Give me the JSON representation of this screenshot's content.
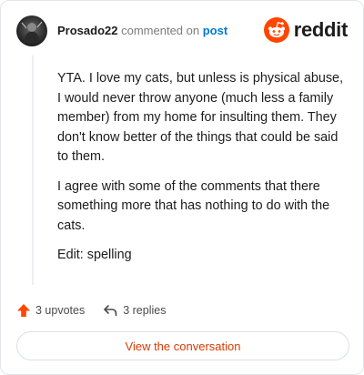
{
  "header": {
    "username": "Prosado22",
    "action_text": "commented on",
    "post_link": "post",
    "brand": "reddit"
  },
  "comment": {
    "paragraphs": [
      "YTA. I love my cats, but unless is physical abuse, I would never throw anyone (much less a family member) from my home for insulting them. They don't know better of the things that could be said to them.",
      "I agree with some of the comments that there something more that has nothing to do with the cats.",
      "Edit: spelling"
    ]
  },
  "actions": {
    "upvotes": "3 upvotes",
    "replies": "3 replies"
  },
  "view_button": "View the conversation",
  "colors": {
    "brand_orange": "#ff4500",
    "link_blue": "#0079d3",
    "cta_text": "#d93a00"
  },
  "icons": {
    "avatar": "user-avatar",
    "brand": "reddit-logo-icon",
    "upvote": "upvote-arrow-icon",
    "reply": "reply-arrow-icon"
  }
}
